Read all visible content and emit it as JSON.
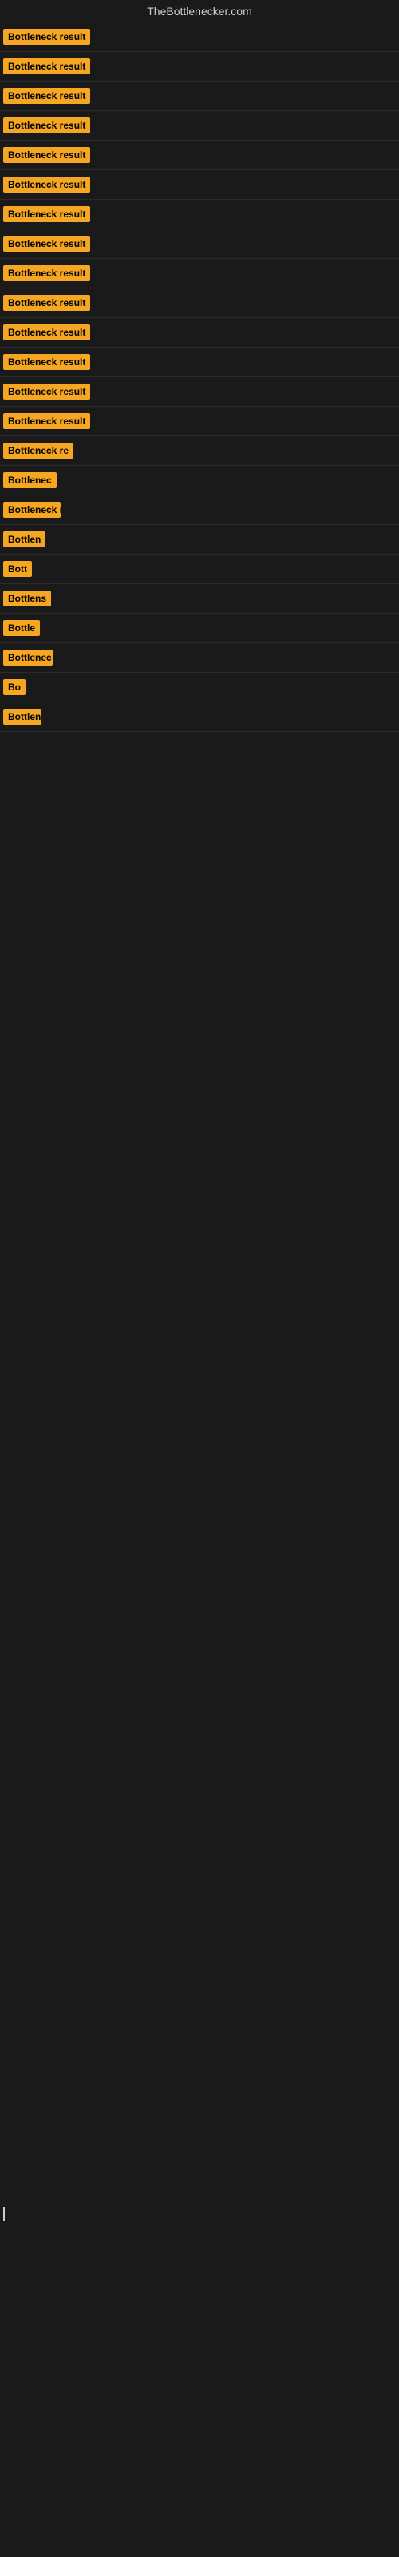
{
  "site": {
    "title": "TheBottlenecker.com"
  },
  "badge_label": "Bottleneck result",
  "rows": [
    {
      "id": 1,
      "width_class": "badge-full",
      "label": "Bottleneck result"
    },
    {
      "id": 2,
      "width_class": "badge-full",
      "label": "Bottleneck result"
    },
    {
      "id": 3,
      "width_class": "badge-full",
      "label": "Bottleneck result"
    },
    {
      "id": 4,
      "width_class": "badge-full",
      "label": "Bottleneck result"
    },
    {
      "id": 5,
      "width_class": "badge-full",
      "label": "Bottleneck result"
    },
    {
      "id": 6,
      "width_class": "badge-full",
      "label": "Bottleneck result"
    },
    {
      "id": 7,
      "width_class": "badge-full",
      "label": "Bottleneck result"
    },
    {
      "id": 8,
      "width_class": "badge-full",
      "label": "Bottleneck result"
    },
    {
      "id": 9,
      "width_class": "badge-full",
      "label": "Bottleneck result"
    },
    {
      "id": 10,
      "width_class": "badge-full",
      "label": "Bottleneck result"
    },
    {
      "id": 11,
      "width_class": "badge-full",
      "label": "Bottleneck result"
    },
    {
      "id": 12,
      "width_class": "badge-full",
      "label": "Bottleneck result"
    },
    {
      "id": 13,
      "width_class": "badge-full",
      "label": "Bottleneck result"
    },
    {
      "id": 14,
      "width_class": "badge-full",
      "label": "Bottleneck result"
    },
    {
      "id": 15,
      "width_class": "badge-w4",
      "label": "Bottleneck re"
    },
    {
      "id": 16,
      "width_class": "badge-w5",
      "label": "Bottlenec"
    },
    {
      "id": 17,
      "width_class": "badge-w6",
      "label": "Bottleneck r"
    },
    {
      "id": 18,
      "width_class": "badge-w7",
      "label": "Bottlen"
    },
    {
      "id": 19,
      "width_class": "badge-w9",
      "label": "Bott"
    },
    {
      "id": 20,
      "width_class": "badge-w8",
      "label": "Bottlens"
    },
    {
      "id": 21,
      "width_class": "badge-w10",
      "label": "Bottle"
    },
    {
      "id": 22,
      "width_class": "badge-w12",
      "label": "Bottlenec"
    },
    {
      "id": 23,
      "width_class": "badge-w13",
      "label": "Bo"
    },
    {
      "id": 24,
      "width_class": "badge-w11",
      "label": "Bottlen"
    }
  ]
}
